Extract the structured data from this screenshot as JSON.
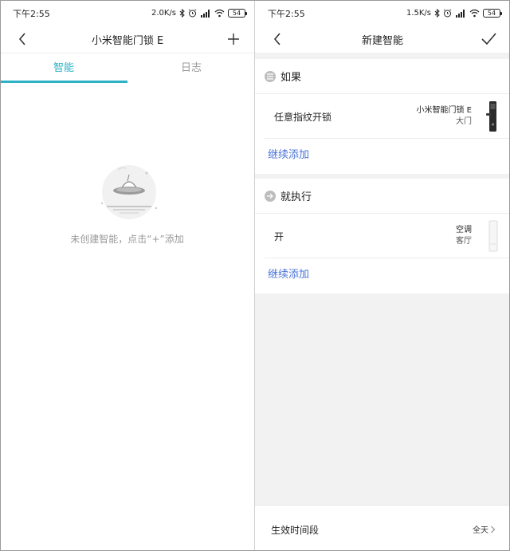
{
  "left": {
    "status": {
      "time": "下午2:55",
      "speed": "2.0K/s",
      "battery": "54"
    },
    "nav": {
      "title": "小米智能门锁 E"
    },
    "tabs": [
      {
        "label": "智能"
      },
      {
        "label": "日志"
      }
    ],
    "empty": {
      "message": "未创建智能，点击“+”添加"
    }
  },
  "right": {
    "status": {
      "time": "下午2:55",
      "speed": "1.5K/s",
      "battery": "54"
    },
    "nav": {
      "title": "新建智能"
    },
    "if_section": {
      "title": "如果",
      "row": {
        "label": "任意指纹开锁",
        "device": "小米智能门锁 E",
        "room": "大门"
      },
      "add_label": "继续添加"
    },
    "then_section": {
      "title": "就执行",
      "row": {
        "label": "开",
        "device": "空调",
        "room": "客厅"
      },
      "add_label": "继续添加"
    },
    "footer": {
      "label": "生效时间段",
      "value": "全天"
    }
  },
  "colors": {
    "accent": "#2cb1c7",
    "link": "#4b74d8"
  }
}
